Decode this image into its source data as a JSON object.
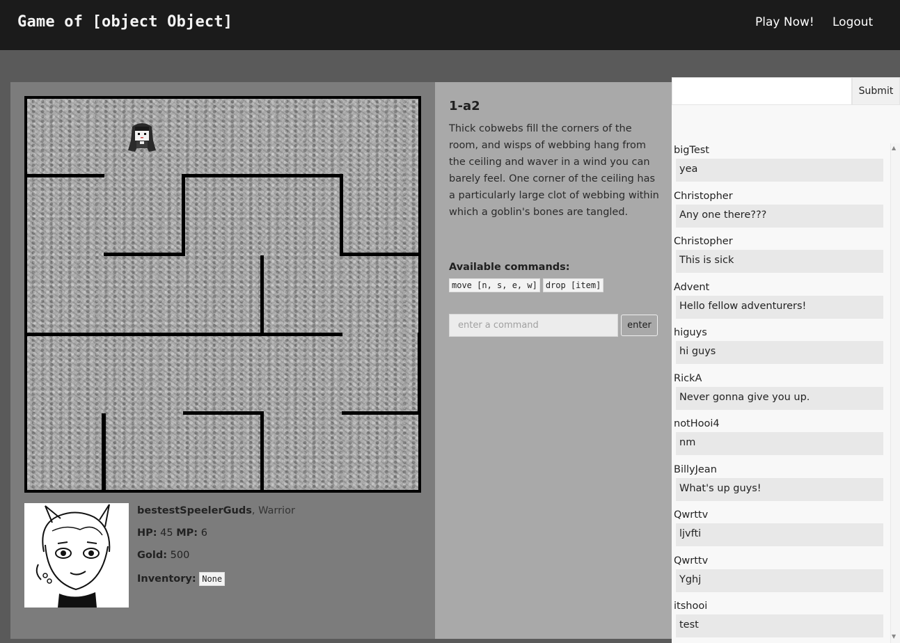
{
  "header": {
    "title": "Game of [object Object]",
    "nav": {
      "play": "Play Now!",
      "logout": "Logout"
    }
  },
  "room": {
    "title": "1-a2",
    "description": "Thick cobwebs fill the corners of the room, and wisps of webbing hang from the ceiling and waver in a wind you can barely feel. One corner of the ceiling has a particularly large clot of webbing within which a goblin's bones are tangled.",
    "commands_title": "Available commands:",
    "commands": [
      "move [n, s, e, w]",
      "drop [item]"
    ],
    "input_placeholder": "enter a command",
    "enter_label": "enter"
  },
  "player": {
    "name": "bestestSpeelerGuds",
    "class_text": ", Warrior",
    "hp_label": "HP:",
    "hp": "45",
    "mp_label": "MP:",
    "mp": "6",
    "gold_label": "Gold:",
    "gold": "500",
    "inventory_label": "Inventory:",
    "inventory": "None"
  },
  "chat": {
    "submit_label": "Submit",
    "messages": [
      {
        "user": "bigTest",
        "text": "yea"
      },
      {
        "user": "Christopher",
        "text": "Any one there???"
      },
      {
        "user": "Christopher",
        "text": "This is sick"
      },
      {
        "user": "Advent",
        "text": "Hello fellow adventurers!"
      },
      {
        "user": "higuys",
        "text": "hi guys"
      },
      {
        "user": "RickA",
        "text": "Never gonna give you up."
      },
      {
        "user": "notHooi4",
        "text": "nm"
      },
      {
        "user": "BillyJean",
        "text": "What's up guys!"
      },
      {
        "user": "Qwrttv",
        "text": "ljvfti"
      },
      {
        "user": "Qwrttv",
        "text": "Yghj"
      },
      {
        "user": "itshooi",
        "text": "test"
      }
    ]
  },
  "icons": {
    "player_sprite": "player-sprite-icon",
    "portrait": "character-portrait"
  }
}
